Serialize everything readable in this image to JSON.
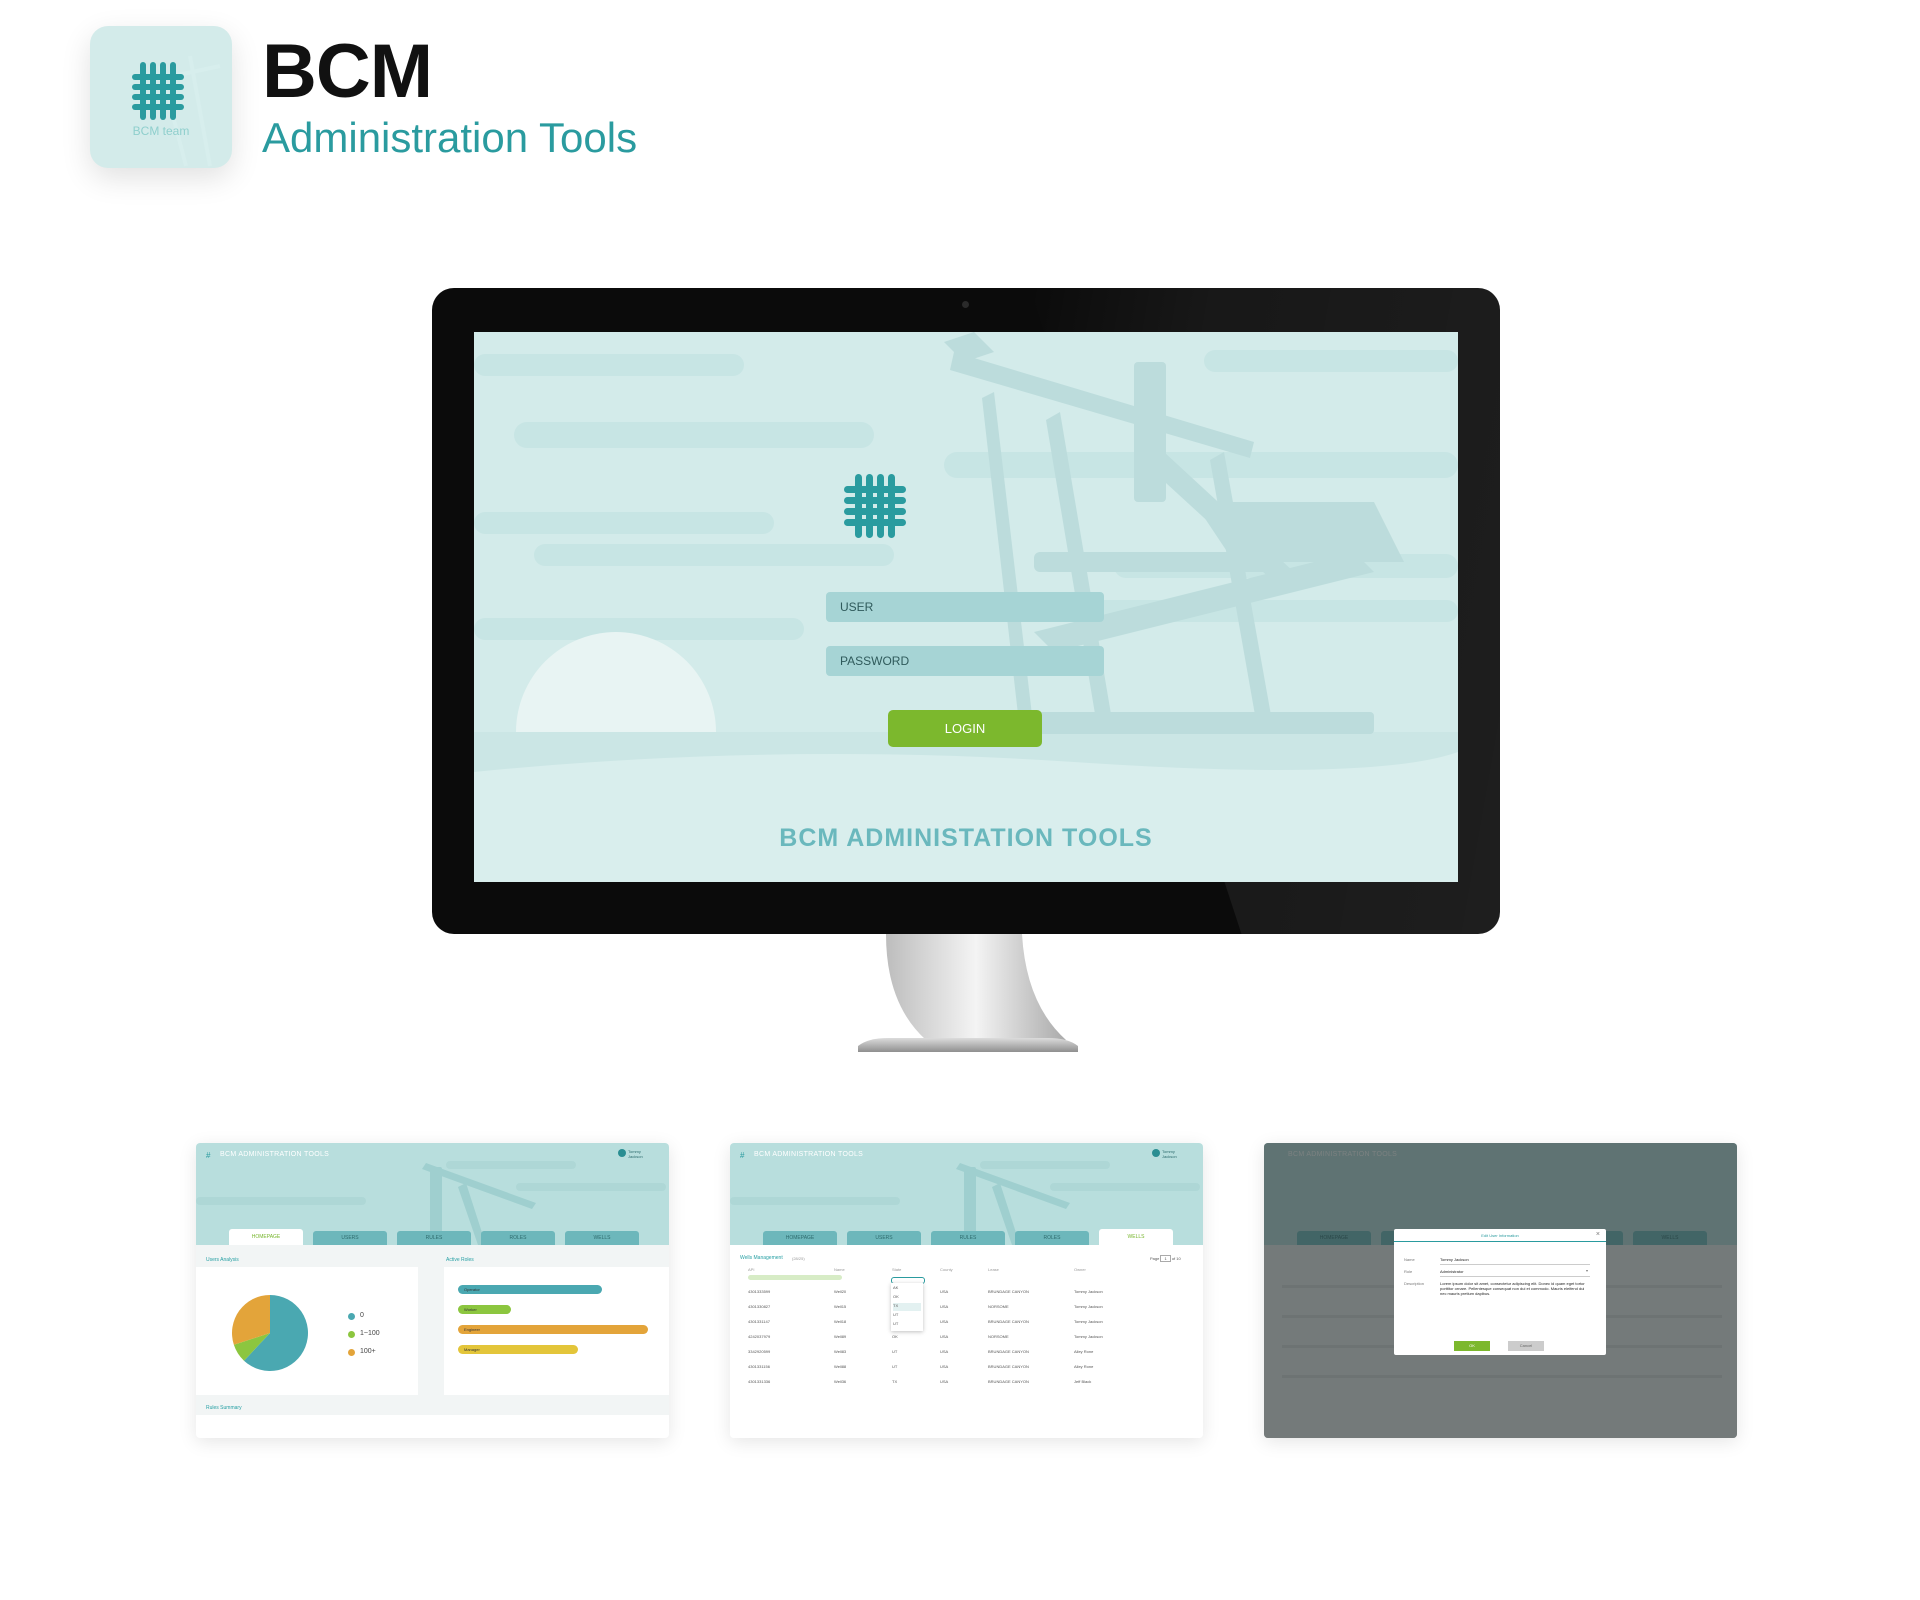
{
  "header": {
    "app_icon_label": "BCM team",
    "title": "BCM",
    "subtitle": "Administration Tools"
  },
  "login_screen": {
    "user_placeholder": "USER",
    "password_placeholder": "PASSWORD",
    "login_button": "LOGIN",
    "footer_title": "BCM ADMINISTATION TOOLS"
  },
  "app_title": "BCM ADMINISTRATION TOOLS",
  "current_user": [
    "Tommy",
    "Jackson"
  ],
  "tabs": [
    "HOMEPAGE",
    "USERS",
    "RULES",
    "ROLES",
    "WELLS"
  ],
  "thumb_home": {
    "users_analysis_title": "Users Analysis",
    "active_roles_title": "Active Roles",
    "rules_summary_title": "Rules Summary",
    "legend": [
      {
        "label": "0",
        "color": "#4aa8b1"
      },
      {
        "label": "1~100",
        "color": "#8cc63f"
      },
      {
        "label": "100+",
        "color": "#e3a43a"
      }
    ],
    "pie_values": [
      0.62,
      0.08,
      0.3
    ],
    "roles": [
      {
        "label": "Operator",
        "color": "#4aa8b1",
        "value": 0.76
      },
      {
        "label": "Worker",
        "color": "#8cc63f",
        "value": 0.28
      },
      {
        "label": "Engineer",
        "color": "#e3a43a",
        "value": 1.0
      },
      {
        "label": "Manager",
        "color": "#e3c53a",
        "value": 0.63
      }
    ]
  },
  "thumb_wells": {
    "section_title": "Wells Management",
    "section_count": "(28/25)",
    "page_label": "Page",
    "page_value": "1",
    "page_total": "of 10",
    "columns": [
      "API",
      "Name",
      "State",
      "County",
      "Lease",
      "Owner"
    ],
    "rows": [
      [
        "4301333599",
        "Well20",
        "",
        "USA",
        "BRUNDAGE CANYON",
        "Tommy Jackson"
      ],
      [
        "4301330827",
        "Well15",
        "",
        "USA",
        "NORSOME",
        "Tommy Jackson"
      ],
      [
        "4301331147",
        "Well18",
        "",
        "USA",
        "BRUNDAGE CANYON",
        "Tommy Jackson"
      ],
      [
        "4242037979",
        "Well89",
        "OK",
        "USA",
        "NORSOME",
        "Tommy Jackson"
      ],
      [
        "3342920599",
        "Well83",
        "UT",
        "USA",
        "BRUNDAGE CANYON",
        "Alley Rone"
      ],
      [
        "4301331156",
        "Well88",
        "UT",
        "USA",
        "BRUNDAGE CANYON",
        "Alley Rone"
      ],
      [
        "4301331336",
        "Well36",
        "TX",
        "USA",
        "BRUNDAGE CANYON",
        "Jeff Black"
      ]
    ],
    "dropdown_options": [
      "AK",
      "OK",
      "TX",
      "UT",
      "UT"
    ]
  },
  "thumb_modal": {
    "modal_title": "Edit User Information",
    "name_label": "Name",
    "name_value": "Tommy Jackson",
    "role_label": "Role",
    "role_value": "Administrator",
    "description_label": "Description",
    "description_value": "Lorem ipsum dolor sit amet, consectetur adipiscing elit. Donec id quam eget tortor porttitor ornare. Pellentesque consequat non dui et commodo. Mauris eleifend dui nec mauris pretium dapibus.",
    "ok_label": "OK",
    "cancel_label": "Cancel"
  }
}
